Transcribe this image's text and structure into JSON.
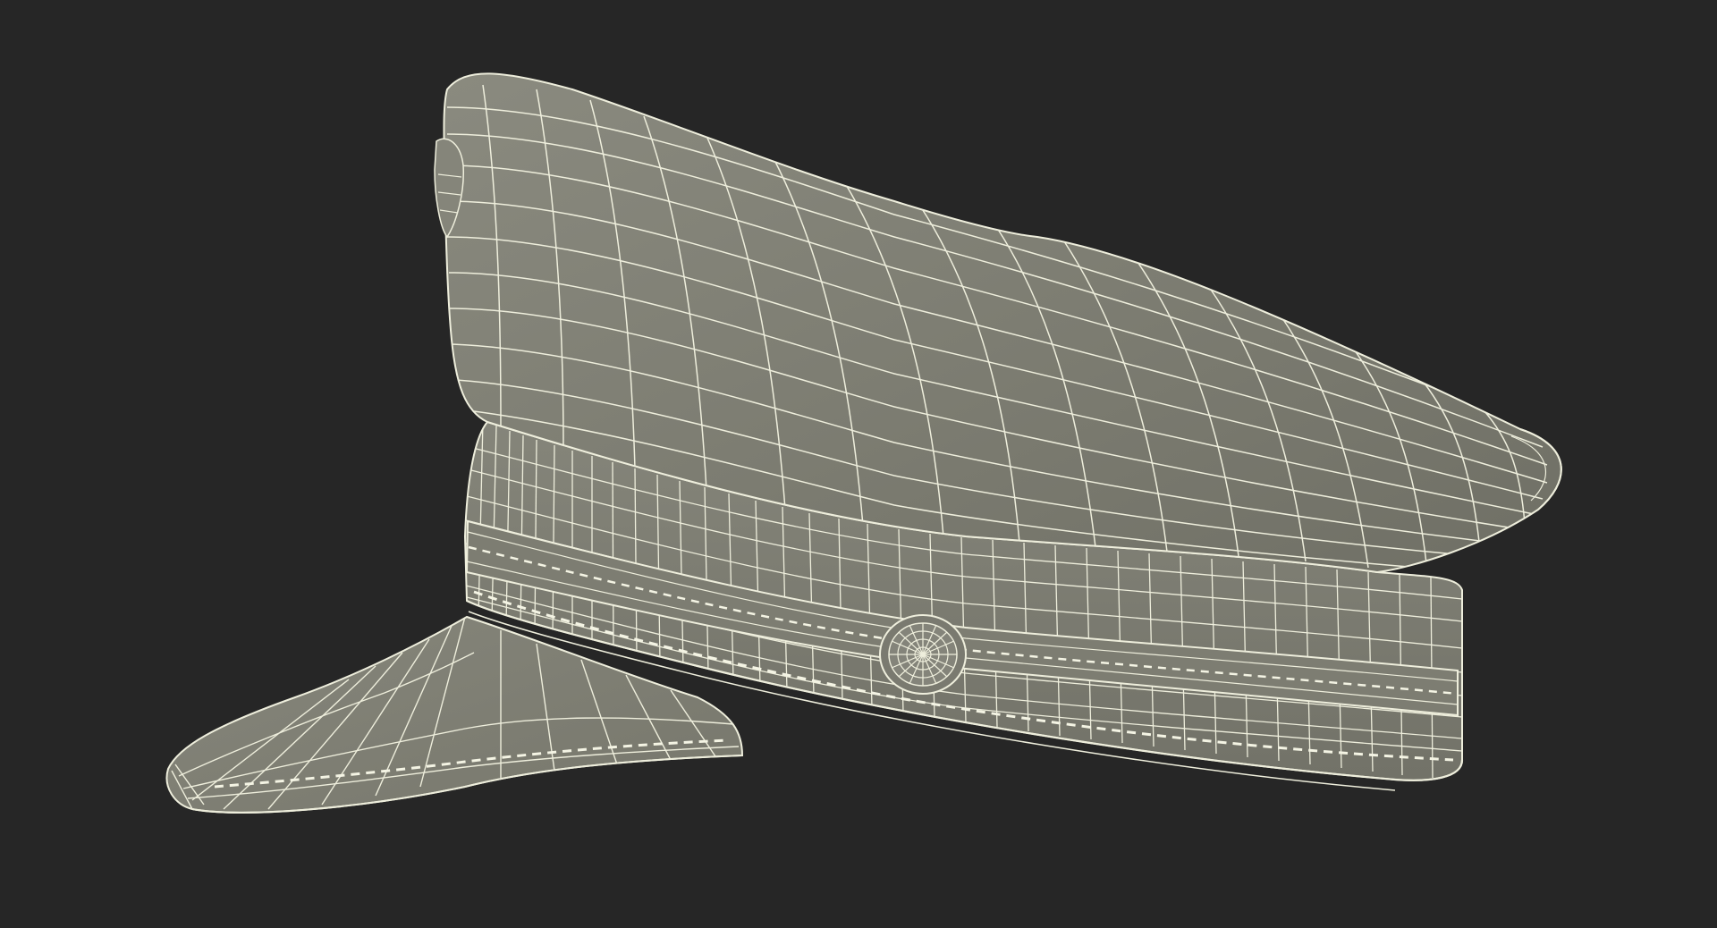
{
  "scene": {
    "subject_icon": "peaked-cap-wireframe-icon",
    "background_color": "#262626",
    "surface_color": "#7f7f74",
    "wire_color": "#eeeedc",
    "stitch_color": "#f4f4e4"
  }
}
